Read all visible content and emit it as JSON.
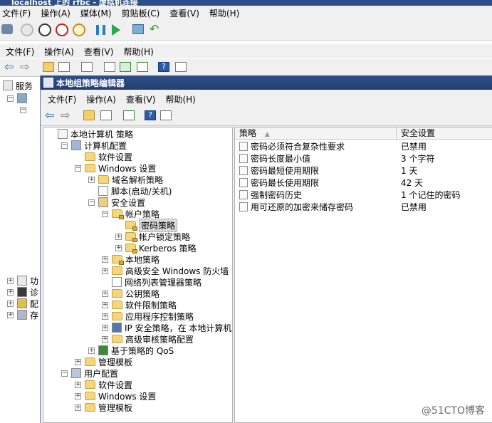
{
  "vm": {
    "title": "localhost 上的 rfbc - 虚拟机连接",
    "menu": [
      "文件(F)",
      "操作(A)",
      "媒体(M)",
      "剪贴板(C)",
      "查看(V)",
      "帮助(H)"
    ]
  },
  "computer_management": {
    "menu": [
      "文件(F)",
      "操作(A)",
      "查看(V)",
      "帮助(H)"
    ],
    "tree": [
      "服务",
      "功",
      "诊",
      "配",
      "存"
    ]
  },
  "gpedit": {
    "title": "本地组策略编辑器",
    "menu": [
      "文件(F)",
      "操作(A)",
      "查看(V)",
      "帮助(H)"
    ],
    "tree": [
      {
        "label": "本地计算机 策略",
        "indent": 0,
        "expander": "",
        "icon": "policy"
      },
      {
        "label": "计算机配置",
        "indent": 1,
        "expander": "−",
        "icon": "computer"
      },
      {
        "label": "软件设置",
        "indent": 2,
        "expander": "",
        "icon": "folder"
      },
      {
        "label": "Windows 设置",
        "indent": 2,
        "expander": "−",
        "icon": "folder"
      },
      {
        "label": "域名解析策略",
        "indent": 3,
        "expander": "+",
        "icon": "folder"
      },
      {
        "label": "脚本(启动/关机)",
        "indent": 3,
        "expander": "",
        "icon": "script"
      },
      {
        "label": "安全设置",
        "indent": 3,
        "expander": "−",
        "icon": "security"
      },
      {
        "label": "帐户策略",
        "indent": 4,
        "expander": "−",
        "icon": "folder-lock"
      },
      {
        "label": "密码策略",
        "indent": 5,
        "expander": "",
        "icon": "folder-lock",
        "selected": true
      },
      {
        "label": "帐户锁定策略",
        "indent": 5,
        "expander": "+",
        "icon": "folder-lock"
      },
      {
        "label": "Kerberos 策略",
        "indent": 5,
        "expander": "+",
        "icon": "folder-lock"
      },
      {
        "label": "本地策略",
        "indent": 4,
        "expander": "+",
        "icon": "folder-lock"
      },
      {
        "label": "高级安全 Windows 防火墙",
        "indent": 4,
        "expander": "+",
        "icon": "folder"
      },
      {
        "label": "网络列表管理器策略",
        "indent": 4,
        "expander": "",
        "icon": "list"
      },
      {
        "label": "公钥策略",
        "indent": 4,
        "expander": "+",
        "icon": "folder"
      },
      {
        "label": "软件限制策略",
        "indent": 4,
        "expander": "+",
        "icon": "folder"
      },
      {
        "label": "应用程序控制策略",
        "indent": 4,
        "expander": "+",
        "icon": "folder"
      },
      {
        "label": "IP 安全策略，在 本地计算机",
        "indent": 4,
        "expander": "+",
        "icon": "ipsec"
      },
      {
        "label": "高级审核策略配置",
        "indent": 4,
        "expander": "+",
        "icon": "folder"
      },
      {
        "label": "基于策略的 QoS",
        "indent": 3,
        "expander": "+",
        "icon": "chart"
      },
      {
        "label": "管理模板",
        "indent": 2,
        "expander": "+",
        "icon": "folder"
      },
      {
        "label": "用户配置",
        "indent": 1,
        "expander": "−",
        "icon": "user"
      },
      {
        "label": "软件设置",
        "indent": 2,
        "expander": "+",
        "icon": "folder"
      },
      {
        "label": "Windows 设置",
        "indent": 2,
        "expander": "+",
        "icon": "folder"
      },
      {
        "label": "管理模板",
        "indent": 2,
        "expander": "+",
        "icon": "folder"
      }
    ],
    "columns": {
      "policy": "策略",
      "setting": "安全设置"
    },
    "rows": [
      {
        "policy": "密码必须符合复杂性要求",
        "setting": "已禁用"
      },
      {
        "policy": "密码长度最小值",
        "setting": "3 个字符"
      },
      {
        "policy": "密码最短使用期限",
        "setting": "1 天"
      },
      {
        "policy": "密码最长使用期限",
        "setting": "42 天"
      },
      {
        "policy": "强制密码历史",
        "setting": "1 个记住的密码"
      },
      {
        "policy": "用可还原的加密来储存密码",
        "setting": "已禁用"
      }
    ]
  },
  "watermark": "@51CTO博客"
}
